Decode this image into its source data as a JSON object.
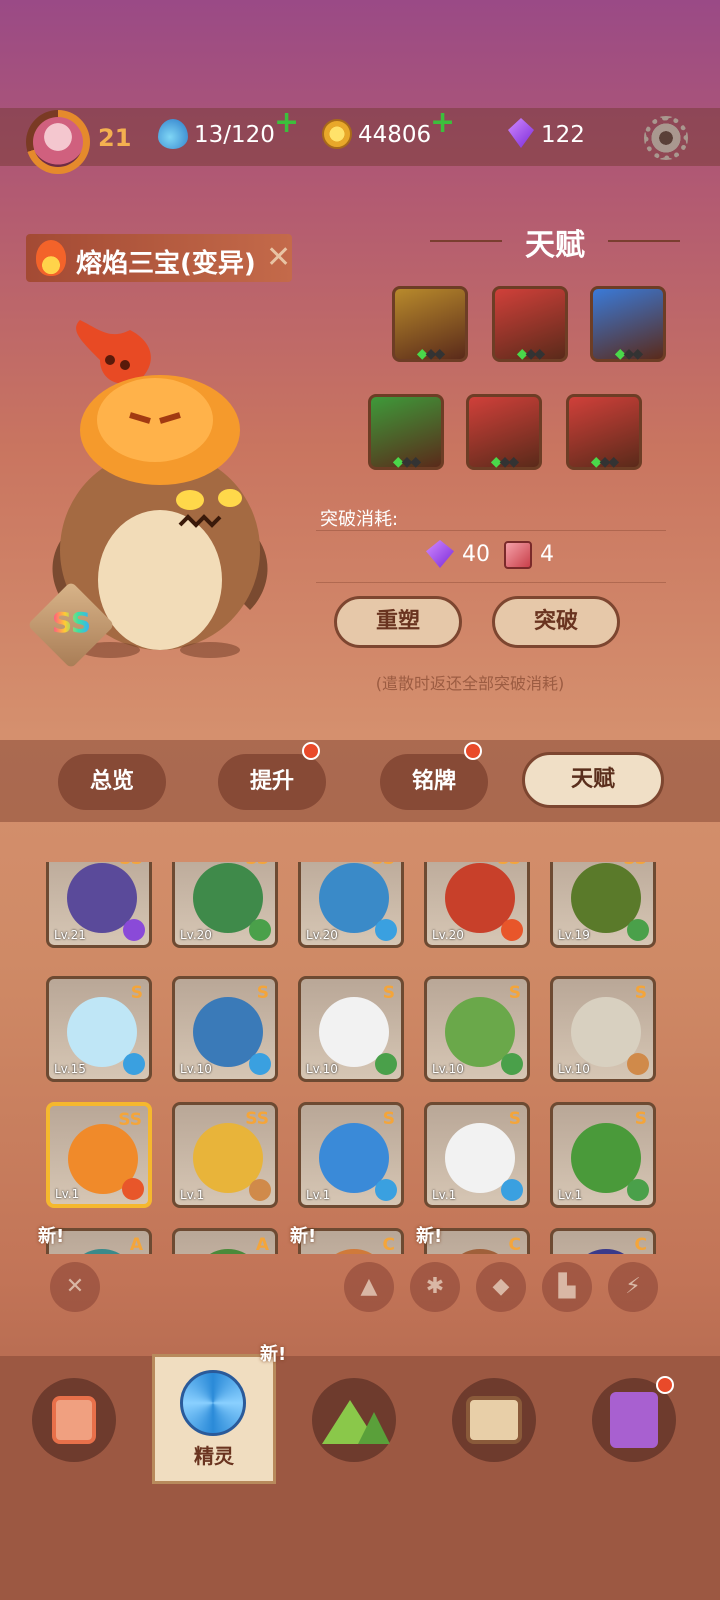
{
  "topbar": {
    "level": "21",
    "stamina": "13/120",
    "coins": "44806",
    "gems": "122",
    "icons": {
      "avatar": "avatar",
      "stamina": "water-drop-icon",
      "coins": "paw-coin-icon",
      "gems": "purple-gem-icon",
      "settings": "gear-icon"
    }
  },
  "pet": {
    "name": "熔焰三宝(变异)",
    "rank": "SS"
  },
  "talent": {
    "title": "天赋",
    "breakthrough_label": "突破消耗:",
    "cost_gems": "40",
    "cost_items": "4",
    "reshape_label": "重塑",
    "breakthrough_btn": "突破",
    "note": "(遣散时返还全部突破消耗)",
    "icons": [
      {
        "name": "crescent-talent-icon",
        "color": "#b88a2c"
      },
      {
        "name": "tiles-talent-icon",
        "color": "#d0403a"
      },
      {
        "name": "eye-talent-icon",
        "color": "#3a7ad8"
      },
      {
        "name": "claw-talent-icon",
        "color": "#3e9a3a"
      },
      {
        "name": "heart-talent-icon",
        "color": "#d0403a"
      },
      {
        "name": "heart-talent-icon",
        "color": "#d0403a"
      }
    ]
  },
  "tabs": [
    {
      "label": "总览",
      "active": false,
      "dot": false
    },
    {
      "label": "提升",
      "active": false,
      "dot": true
    },
    {
      "label": "铭牌",
      "active": false,
      "dot": true
    },
    {
      "label": "天赋",
      "active": true,
      "dot": false
    }
  ],
  "pets": [
    {
      "rank": "SS",
      "lv": "Lv.21",
      "el": "#8a4ad8",
      "face": "#5a4a9a"
    },
    {
      "rank": "SS",
      "lv": "Lv.20",
      "el": "#4aa04a",
      "face": "#3f8a4a"
    },
    {
      "rank": "SS",
      "lv": "Lv.20",
      "el": "#3aa0e0",
      "face": "#3a8ac8"
    },
    {
      "rank": "SS",
      "lv": "Lv.20",
      "el": "#e8562a",
      "face": "#c8402a"
    },
    {
      "rank": "SS",
      "lv": "Lv.19",
      "el": "#4aa04a",
      "face": "#5a7a2a"
    },
    {
      "rank": "S",
      "lv": "Lv.15",
      "el": "#3aa0e0",
      "face": "#bfe6f6"
    },
    {
      "rank": "S",
      "lv": "Lv.10",
      "el": "#3aa0e0",
      "face": "#3a7ab8"
    },
    {
      "rank": "S",
      "lv": "Lv.10",
      "el": "#4aa04a",
      "face": "#f2f2f2"
    },
    {
      "rank": "S",
      "lv": "Lv.10",
      "el": "#4aa04a",
      "face": "#6aa84a"
    },
    {
      "rank": "S",
      "lv": "Lv.10",
      "el": "#d08a4a",
      "face": "#d8d0c0"
    },
    {
      "rank": "SS",
      "lv": "Lv.1",
      "el": "#e8562a",
      "face": "#f08a2a"
    },
    {
      "rank": "SS",
      "lv": "Lv.1",
      "el": "#d08a4a",
      "face": "#e8b43a"
    },
    {
      "rank": "S",
      "lv": "Lv.1",
      "el": "#3aa0e0",
      "face": "#3a8ad8"
    },
    {
      "rank": "S",
      "lv": "Lv.1",
      "el": "#3aa0e0",
      "face": "#f2f2f2"
    },
    {
      "rank": "S",
      "lv": "Lv.1",
      "el": "#4aa04a",
      "face": "#4a9a3a"
    },
    {
      "rank": "A",
      "lv": "",
      "el": "",
      "face": "#3a8a8a",
      "new": "新!"
    },
    {
      "rank": "A",
      "lv": "",
      "el": "",
      "face": "#4a8a3a",
      "new": ""
    },
    {
      "rank": "C",
      "lv": "",
      "el": "",
      "face": "#d07a3a",
      "new": "新!"
    },
    {
      "rank": "C",
      "lv": "",
      "el": "",
      "face": "#a0603a",
      "new": "新!"
    },
    {
      "rank": "C",
      "lv": "",
      "el": "",
      "face": "#3a3a8a",
      "new": ""
    }
  ],
  "filters": [
    "fire-filter-icon",
    "ice-filter-icon",
    "leaf-filter-icon",
    "rock-filter-icon",
    "lightning-filter-icon"
  ],
  "nav": {
    "active_label": "精灵",
    "new_tag": "新!",
    "items": [
      "device-icon",
      "spirit-icon",
      "mountain-icon",
      "chest-icon",
      "map-pin-icon"
    ]
  },
  "colors": {
    "accent": "#f4b050",
    "plus": "#3cbf3c",
    "reddot": "#e94a2a"
  }
}
